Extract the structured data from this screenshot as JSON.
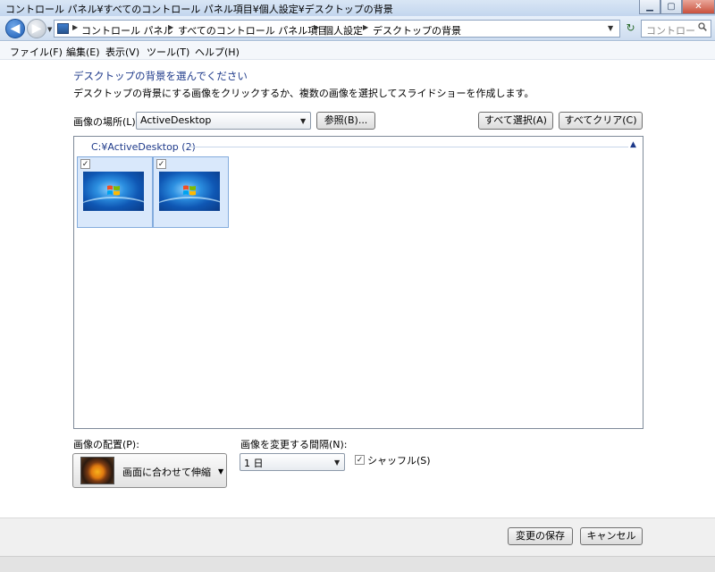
{
  "window": {
    "title": "コントロール パネル¥すべてのコントロール パネル項目¥個人設定¥デスクトップの背景",
    "buttons": [
      "minimize",
      "maximize",
      "close"
    ]
  },
  "navigation": {
    "breadcrumbs": [
      "コントロール パネル",
      "すべてのコントロール パネル項目",
      "個人設定",
      "デスクトップの背景"
    ],
    "search_placeholder": "コントロール パネ"
  },
  "menu": [
    "ファイル(F)",
    "編集(E)",
    "表示(V)",
    "ツール(T)",
    "ヘルプ(H)"
  ],
  "page": {
    "heading": "デスクトップの背景を選んでください",
    "description": "デスクトップの背景にする画像をクリックするか、複数の画像を選択してスライドショーを作成します。"
  },
  "location": {
    "label": "画像の場所(L):",
    "value": "ActiveDesktop",
    "browse_button": "参照(B)...",
    "select_all_button": "すべて選択(A)",
    "clear_all_button": "すべてクリア(C)"
  },
  "gallery": {
    "group_header": "C:¥ActiveDesktop (2)",
    "items": [
      {
        "checked": true,
        "check_mark": "✓"
      },
      {
        "checked": true,
        "check_mark": "✓"
      }
    ]
  },
  "position": {
    "label": "画像の配置(P):",
    "value": "画面に合わせて伸縮"
  },
  "interval": {
    "label": "画像を変更する間隔(N):",
    "value": "1 日"
  },
  "shuffle": {
    "label": "シャッフル(S)",
    "checked": true,
    "check_mark": "✓"
  },
  "actions": {
    "save_button": "変更の保存",
    "cancel_button": "キャンセル"
  }
}
